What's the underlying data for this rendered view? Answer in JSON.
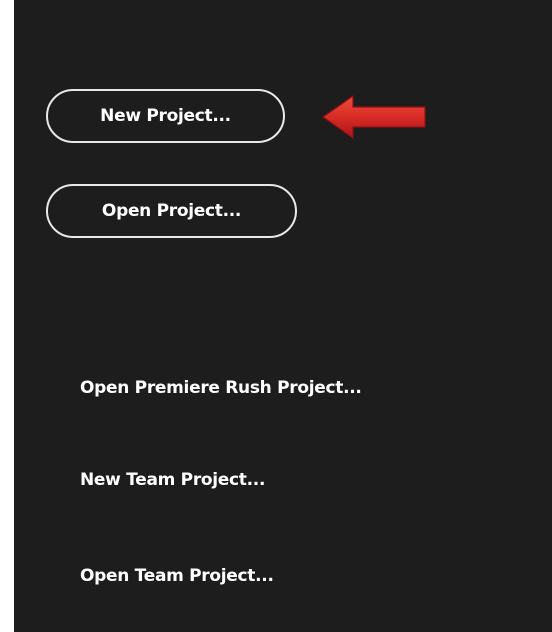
{
  "start_panel": {
    "primary_buttons": {
      "new_project": "New Project...",
      "open_project": "Open Project..."
    },
    "links": {
      "open_rush_project": "Open Premiere Rush Project...",
      "new_team_project": "New Team Project...",
      "open_team_project": "Open Team Project..."
    }
  },
  "annotation": {
    "arrow_icon": "left-pointing-red-arrow-icon",
    "arrow_color": "#d42a24"
  },
  "colors": {
    "panel_background": "#1d1d1d",
    "text": "#ffffff",
    "button_border": "#e8e8e8"
  }
}
